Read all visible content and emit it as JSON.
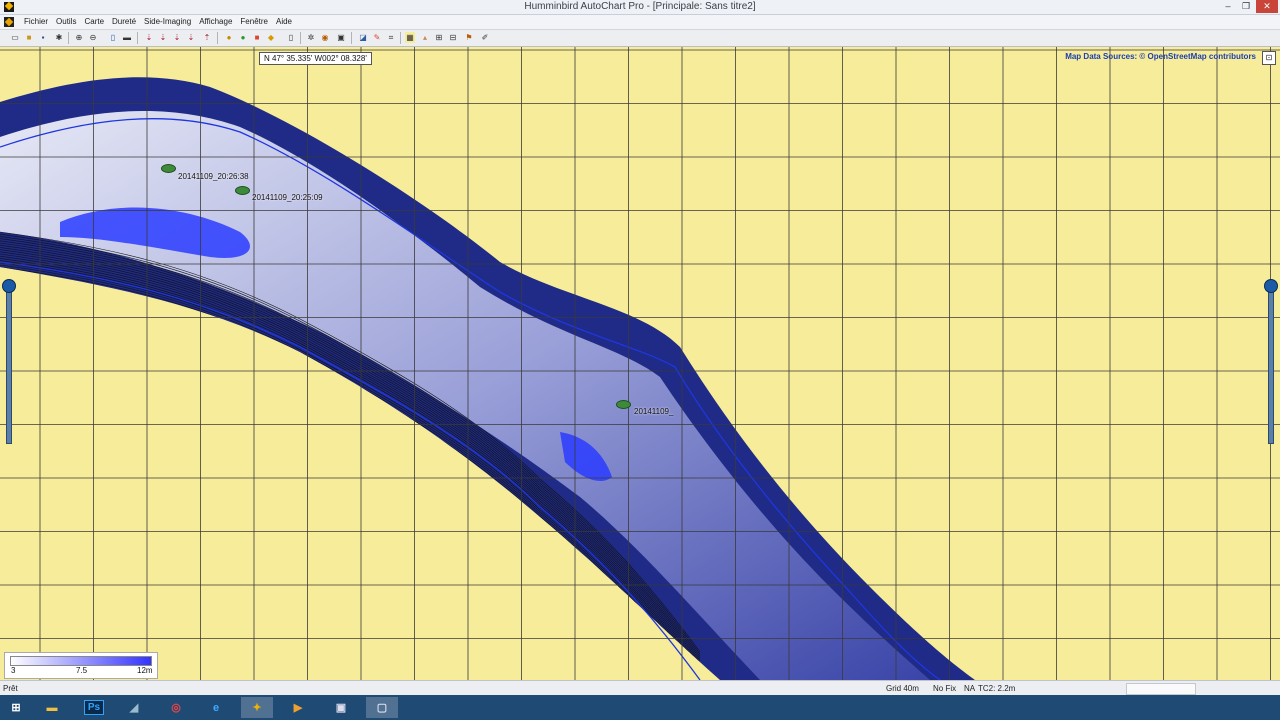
{
  "window": {
    "title": "Humminbird AutoChart Pro - [Principale: Sans titre2]",
    "minimize": "–",
    "restore": "❐",
    "close": "✕"
  },
  "menu": {
    "items": [
      "Fichier",
      "Outils",
      "Carte",
      "Dureté",
      "Side-Imaging",
      "Affichage",
      "Fenêtre",
      "Aide"
    ]
  },
  "toolbar": {
    "icons": [
      "new-file-icon",
      "open-folder-icon",
      "save-icon",
      "settings-icon",
      "zoom-in-icon",
      "zoom-out-icon",
      "select-icon",
      "measure-icon",
      "import-track-icon",
      "import-waypoint-icon",
      "export-icon",
      "export-card-icon",
      "export-map-icon",
      "green-circle-icon",
      "orange-circle-icon",
      "layer-red-icon",
      "layer-yellow-icon",
      "page-icon",
      "gear-icon",
      "target-icon",
      "zoom-window-icon",
      "edit-chart-icon",
      "pencil-red-icon",
      "grid-icon",
      "contour-icon",
      "depth-shade-icon",
      "side-image-icon",
      "hardness-icon",
      "waypoint-icon",
      "pen-icon"
    ]
  },
  "map": {
    "coordinate_readout": "N 47° 35.335' W002° 08.328'",
    "attribution": "Map Data Sources: © OpenStreetMap contributors",
    "fish_markers": [
      {
        "label": "20141109_20:26:38"
      },
      {
        "label": "20141109_20:25:09"
      },
      {
        "label": "20141109_"
      }
    ],
    "colors": {
      "land": "#f6ec9a",
      "deep_blue": "#1f2b86",
      "contour_blue": "#1e36e0",
      "grid": "#3a3a3a"
    }
  },
  "legend": {
    "min": "3",
    "mid": "7.5",
    "max": "12m"
  },
  "status": {
    "ready": "Prêt",
    "grid": "Grid 40m",
    "fix": "No Fix",
    "na": "NA",
    "tc": "TC2: 2.2m"
  },
  "taskbar": {
    "apps": [
      "start-icon",
      "file-explorer-icon",
      "photoshop-icon",
      "app-icon",
      "chrome-icon",
      "internet-explorer-icon",
      "humminbird-icon",
      "media-player-icon",
      "app-window-icon",
      "app-window-icon-2"
    ],
    "photoshop_label": "Ps"
  }
}
